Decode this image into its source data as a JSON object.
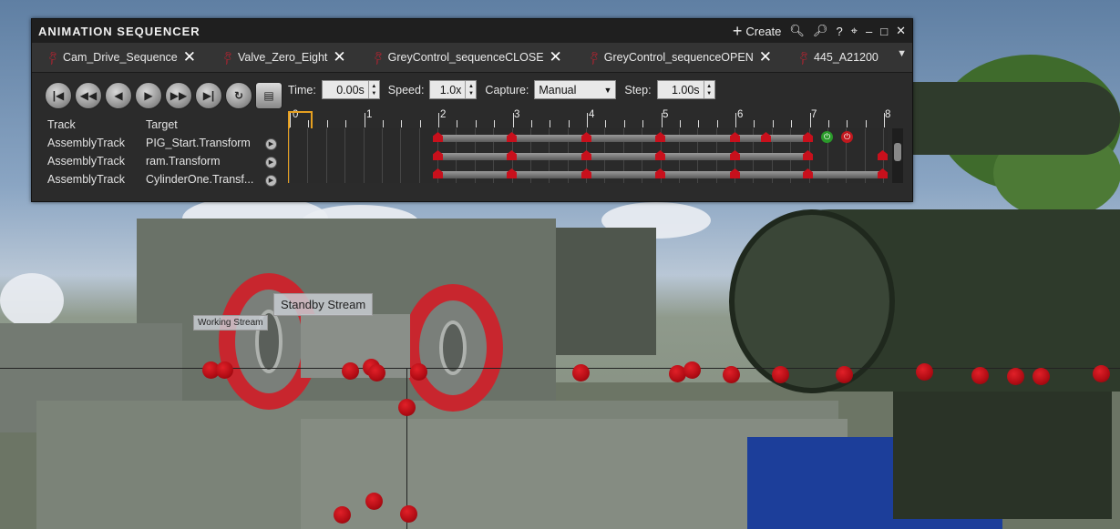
{
  "scene": {
    "label_working": "Working Stream",
    "label_standby": "Standby Stream"
  },
  "sequencer": {
    "title": "ANIMATION SEQUENCER",
    "create_label": "Create",
    "tabs": [
      {
        "label": "Cam_Drive_Sequence"
      },
      {
        "label": "Valve_Zero_Eight"
      },
      {
        "label": "GreyControl_sequenceCLOSE"
      },
      {
        "label": "GreyControl_sequenceOPEN"
      },
      {
        "label": "445_A21200"
      }
    ],
    "controls": {
      "time_label": "Time:",
      "time_value": "0.00s",
      "speed_label": "Speed:",
      "speed_value": "1.0x",
      "capture_label": "Capture:",
      "capture_value": "Manual",
      "step_label": "Step:",
      "step_value": "1.00s"
    },
    "columns": {
      "track": "Track",
      "target": "Target"
    },
    "tracks": [
      {
        "track": "AssemblyTrack",
        "target": "PIG_Start.Transform"
      },
      {
        "track": "AssemblyTrack",
        "target": "ram.Transform"
      },
      {
        "track": "AssemblyTrack",
        "target": "CylinderOne.Transf..."
      }
    ],
    "ruler_labels": [
      "0",
      "1",
      "2",
      "3",
      "4",
      "5",
      "6",
      "7",
      "8"
    ]
  }
}
